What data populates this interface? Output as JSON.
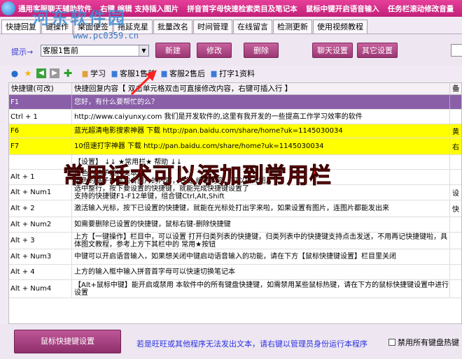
{
  "window": {
    "title_segments": [
      "通用客服聊天辅助软件",
      "右键 编辑 支持插入图片",
      "拼音首字母快速检索类目及笔记本",
      "鼠标中键开启语音输入",
      "任务栏滚动修改音量"
    ]
  },
  "watermark": {
    "text": "河东软件园",
    "url": "www.pc0359.cn"
  },
  "tabs": [
    {
      "label": "快捷回复"
    },
    {
      "label": "键操作"
    },
    {
      "label": "桌面便签"
    },
    {
      "label": "拖延克星"
    },
    {
      "label": "批量改名"
    },
    {
      "label": "时间管理"
    },
    {
      "label": "在线留言"
    },
    {
      "label": "检测更新"
    },
    {
      "label": "使用视频教程"
    }
  ],
  "toolbar": {
    "prompt_label": "提示→",
    "category_value": "客服1售前",
    "new_btn": "新建",
    "edit_btn": "修改",
    "delete_btn": "删除",
    "chat_settings_btn": "聊天设置",
    "other_settings_btn": "其它设置"
  },
  "quickbar": {
    "icons": [
      "globe-icon",
      "star-icon",
      "back-icon",
      "forward-icon",
      "plus-icon"
    ],
    "items": [
      {
        "label": "学习",
        "icon": "folder-icon"
      },
      {
        "label": "客服1售前",
        "icon": "doc-icon"
      },
      {
        "label": "客服2售后",
        "icon": "doc-icon"
      },
      {
        "label": "打字1资料",
        "icon": "doc-icon"
      }
    ]
  },
  "table": {
    "headers": [
      "快捷键(可改)",
      "快捷回复内容【 双击单元格双击可直接修改内容，右键可插入行 】",
      "备"
    ],
    "rows": [
      {
        "key": "F1",
        "text": [
          "您好，有什么要帮忙的么？"
        ],
        "extra": "",
        "style": "sel"
      },
      {
        "key": "Ctrl + 1",
        "text": [
          "http://www.caiyunxy.com  我们是开发软件的,这里有我开发的一些提高工作学习效率的软件"
        ],
        "extra": "",
        "style": ""
      },
      {
        "key": "F6",
        "text": [
          "蓝光超清电影搜索神器 下载 http://pan.baidu.com/share/home?uk=1145030034"
        ],
        "extra": "黄",
        "style": "yel"
      },
      {
        "key": "F7",
        "text": [
          "10倍速打字神器 下载 http://pan.baidu.com/share/home?uk=1145030034"
        ],
        "extra": "右",
        "style": "yel"
      },
      {
        "key": "",
        "text": [
          "【设置】 ↓↓ ★常用栏★ 帮助 ↓↓"
        ],
        "extra": "",
        "style": ""
      },
      {
        "key": "Alt + 1",
        "text": [
          "白色的格子是纯文本",
          "黄色的格子中是包含图片的内容，右键-编辑内容，可以插入图片"
        ],
        "extra": "",
        "style": ""
      },
      {
        "key": "Alt + Num1",
        "text": [
          "选中整行，按下要设置的快捷键，就能完成快捷键设置了",
          "支持的快捷键F1-F12单键，组合键Ctrl,Alt,Shift"
        ],
        "extra": "设",
        "style": ""
      },
      {
        "key": "Alt + 2",
        "text": [
          "激活输入光标，按下已设置的快捷键，就能在光标处打出字来啦，如果设置有图片，连图片都能发出来"
        ],
        "extra": "快",
        "style": ""
      },
      {
        "key": "Alt + Num2",
        "text": [
          "如需要删除已设置的快捷键，鼠标右键-删除快捷键"
        ],
        "extra": "",
        "style": ""
      },
      {
        "key": "Alt + 3",
        "text": [
          "上方【一键操作】栏目中，可以设置 打开归类列表的快捷键，归类列表中的快捷键支持点击发送，不用再记快捷键啦，具体图文教程，参考上方下其栏中的 常用★按钮"
        ],
        "extra": "",
        "style": ""
      },
      {
        "key": "Alt + Num3",
        "text": [
          "中键可以开启语音输入，如果想关闭中键启动语音输入的功能，请在下方【鼠标快捷键设置】栏目里关闭"
        ],
        "extra": "",
        "style": ""
      },
      {
        "key": "Alt + 4",
        "text": [
          "上方的输入框中输入拼音首字母可以快速切换笔记本"
        ],
        "extra": "",
        "style": ""
      },
      {
        "key": "Alt + Num4",
        "text": [
          "【Alt+鼠标中键】能开启或禁用 本软件中的所有键盘快捷键，如需禁用某些鼠标热键，请在下方的鼠标快捷键设置中进行设置"
        ],
        "extra": "",
        "style": ""
      }
    ]
  },
  "banner": {
    "text": "常用话术可以添加到常用栏"
  },
  "bottom": {
    "mouse_btn": "鼠标快捷键设置",
    "note": "若是旺旺或其他程序无法发出文本，请右键以管理员身份运行本程序",
    "checkbox_label": "禁用所有键盘热键"
  },
  "colors": {
    "title": "#d6308a",
    "accent": "#a04a8a",
    "selected_row": "#8a5fa8",
    "highlight_row": "#ffff00",
    "banner": "#ff1d1d"
  }
}
